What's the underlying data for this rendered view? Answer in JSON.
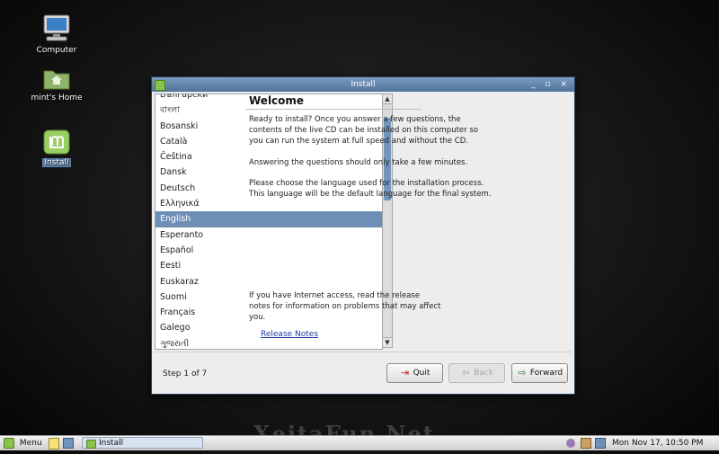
{
  "desktop": {
    "icons": [
      {
        "label": "Computer"
      },
      {
        "label": "mint's Home"
      },
      {
        "label": "Install"
      }
    ]
  },
  "window": {
    "title": "Install",
    "controls": "_ ▫ ×",
    "languages": [
      "Български",
      "বাংলা",
      "Bosanski",
      "Català",
      "Čeština",
      "Dansk",
      "Deutsch",
      "Ελληνικά",
      "English",
      "Esperanto",
      "Español",
      "Eesti",
      "Euskaraz",
      "Suomi",
      "Français",
      "Galego",
      "ગુજરાતી"
    ],
    "selected_language": "English",
    "heading": "Welcome",
    "intro_line1": "Ready to install? Once you answer a few questions, the",
    "intro_line2": "contents of the live CD can be installed on this computer so",
    "intro_line3": "you can run the system at full speed and without the CD.",
    "answering": "Answering the questions should only take a few minutes.",
    "choose_line1": "Please choose the language used for the installation process.",
    "choose_line2": "This language will be the default language for the final system.",
    "internet_line1": "If you have Internet access, read the release",
    "internet_line2": "notes for information on problems that may affect",
    "internet_line3": "you.",
    "release_notes": "Release Notes",
    "step": "Step 1 of 7",
    "buttons": {
      "quit": "Quit",
      "back": "Back",
      "forward": "Forward"
    }
  },
  "taskbar": {
    "menu": "Menu",
    "task": "Install",
    "clock": "Mon Nov 17, 10:50 PM"
  },
  "watermark": "XeitaFun.Net",
  "colors": {
    "selection": "#6d8fb5",
    "titlebar": "#5f83ab",
    "link": "#1b3aa6"
  }
}
